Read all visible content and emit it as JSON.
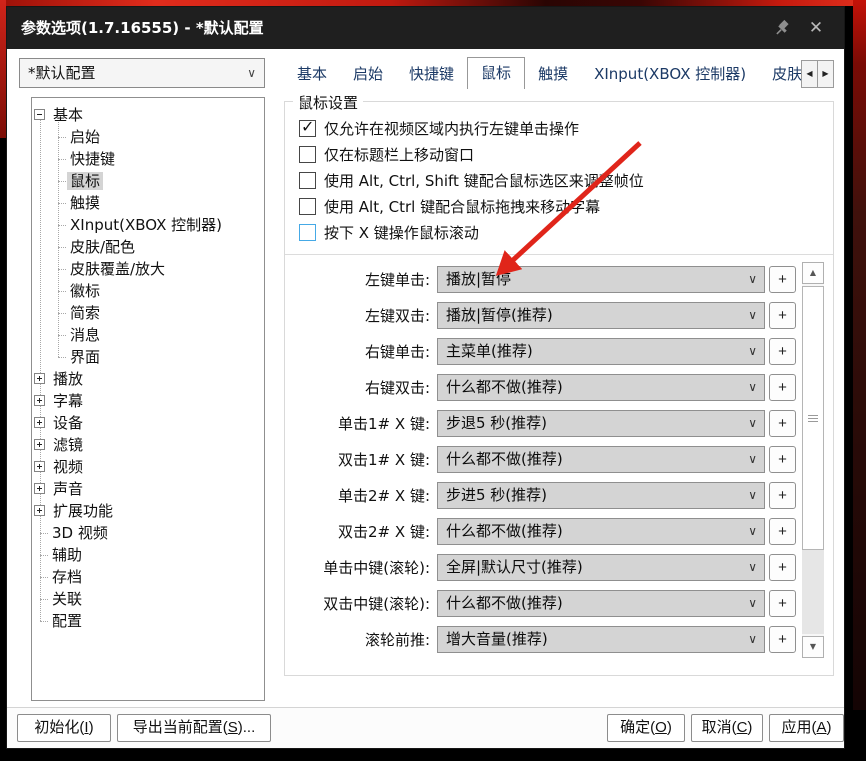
{
  "window": {
    "title": "参数选项(1.7.16555) - *默认配置"
  },
  "profile_combo": {
    "value": "*默认配置"
  },
  "tabs": {
    "items": [
      {
        "label": "基本"
      },
      {
        "label": "启始"
      },
      {
        "label": "快捷键"
      },
      {
        "label": "鼠标",
        "selected": true
      },
      {
        "label": "触摸"
      },
      {
        "label": "XInput(XBOX 控制器)"
      },
      {
        "label": "皮肤/配"
      }
    ]
  },
  "tree": {
    "items": [
      {
        "label": "基本",
        "type": "root-expanded",
        "expanded": true
      },
      {
        "label": "启始",
        "type": "child"
      },
      {
        "label": "快捷键",
        "type": "child"
      },
      {
        "label": "鼠标",
        "type": "child",
        "selected": true
      },
      {
        "label": "触摸",
        "type": "child"
      },
      {
        "label": "XInput(XBOX 控制器)",
        "type": "child"
      },
      {
        "label": "皮肤/配色",
        "type": "child"
      },
      {
        "label": "皮肤覆盖/放大",
        "type": "child"
      },
      {
        "label": "徽标",
        "type": "child"
      },
      {
        "label": "简索",
        "type": "child"
      },
      {
        "label": "消息",
        "type": "child"
      },
      {
        "label": "界面",
        "type": "child"
      },
      {
        "label": "播放",
        "type": "collapsed"
      },
      {
        "label": "字幕",
        "type": "collapsed"
      },
      {
        "label": "设备",
        "type": "collapsed"
      },
      {
        "label": "滤镜",
        "type": "collapsed"
      },
      {
        "label": "视频",
        "type": "collapsed"
      },
      {
        "label": "声音",
        "type": "collapsed"
      },
      {
        "label": "扩展功能",
        "type": "collapsed"
      },
      {
        "label": "3D 视频",
        "type": "leaf"
      },
      {
        "label": "辅助",
        "type": "leaf"
      },
      {
        "label": "存档",
        "type": "leaf"
      },
      {
        "label": "关联",
        "type": "leaf"
      },
      {
        "label": "配置",
        "type": "leaf"
      }
    ]
  },
  "mouse_settings": {
    "group_title": "鼠标设置",
    "checkboxes": [
      {
        "label": "仅允许在视频区域内执行左键单击操作",
        "checked": true
      },
      {
        "label": "仅在标题栏上移动窗口",
        "checked": false
      },
      {
        "label": "使用 Alt, Ctrl, Shift 键配合鼠标选区来调整帧位",
        "checked": false
      },
      {
        "label": "使用 Alt, Ctrl 键配合鼠标拖拽来移动字幕",
        "checked": false
      },
      {
        "label": "按下 X 键操作鼠标滚动",
        "checked": false,
        "focused": true
      }
    ],
    "bindings": [
      {
        "label": "左键单击:",
        "value": "播放|暂停"
      },
      {
        "label": "左键双击:",
        "value": "播放|暂停(推荐)"
      },
      {
        "label": "右键单击:",
        "value": "主菜单(推荐)"
      },
      {
        "label": "右键双击:",
        "value": "什么都不做(推荐)"
      },
      {
        "label": "单击1# X 键:",
        "value": "步退5 秒(推荐)"
      },
      {
        "label": "双击1# X 键:",
        "value": "什么都不做(推荐)"
      },
      {
        "label": "单击2# X 键:",
        "value": "步进5 秒(推荐)"
      },
      {
        "label": "双击2# X 键:",
        "value": "什么都不做(推荐)"
      },
      {
        "label": "单击中键(滚轮):",
        "value": "全屏|默认尺寸(推荐)"
      },
      {
        "label": "双击中键(滚轮):",
        "value": "什么都不做(推荐)"
      },
      {
        "label": "滚轮前推:",
        "value": "增大音量(推荐)"
      }
    ],
    "add_button_label": "+"
  },
  "footer": {
    "init": {
      "pre": "初始化(",
      "key": "I",
      "post": ")"
    },
    "export": {
      "pre": "导出当前配置(",
      "key": "S",
      "post": ")..."
    },
    "ok": {
      "pre": "确定(",
      "key": "O",
      "post": ")"
    },
    "cancel": {
      "pre": "取消(",
      "key": "C",
      "post": ")"
    },
    "apply": {
      "pre": "应用(",
      "key": "A",
      "post": ")"
    }
  },
  "icons": {
    "pin": "pin-icon",
    "close": "✕",
    "combo_chevron": "∨",
    "dropdown_chevron": "∨",
    "tab_prev": "◀",
    "tab_next": "▶",
    "scroll_up": "▲",
    "scroll_down": "▼",
    "check": "✓"
  },
  "colors": {
    "annotation_red": "#e0251a",
    "titlebar_bg": "#1f1f1f",
    "tab_text": "#1c3a66",
    "checkbox_focus_blue": "#45a9e6",
    "tree_selected_bg": "#d4d4d4"
  }
}
